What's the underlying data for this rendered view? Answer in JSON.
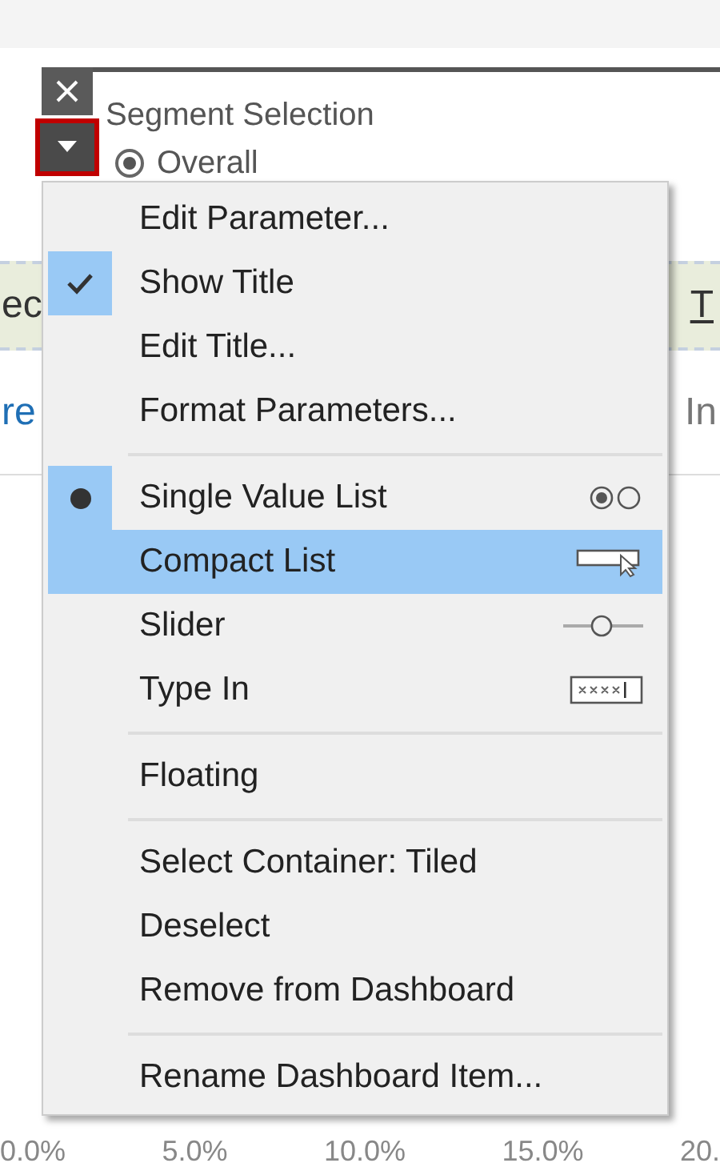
{
  "panel": {
    "title": "Segment Selection",
    "option": {
      "label": "Overall",
      "selected": true
    }
  },
  "background": {
    "band_left": "ec",
    "band_right": "T",
    "row_left": "re",
    "row_right": "In",
    "axis_ticks": [
      "0.0%",
      "5.0%",
      "10.0%",
      "15.0%",
      "20."
    ]
  },
  "menu": {
    "items": [
      {
        "kind": "command",
        "label": "Edit Parameter...",
        "highlighted": false
      },
      {
        "kind": "toggle",
        "label": "Show Title",
        "checked": true,
        "highlighted": false
      },
      {
        "kind": "command",
        "label": "Edit Title...",
        "highlighted": false
      },
      {
        "kind": "command",
        "label": "Format Parameters...",
        "highlighted": false
      },
      {
        "kind": "separator"
      },
      {
        "kind": "mode",
        "label": "Single Value List",
        "selected": true,
        "highlighted": false
      },
      {
        "kind": "mode",
        "label": "Compact List",
        "selected": false,
        "highlighted": true
      },
      {
        "kind": "mode",
        "label": "Slider",
        "selected": false,
        "highlighted": false
      },
      {
        "kind": "mode",
        "label": "Type In",
        "selected": false,
        "highlighted": false
      },
      {
        "kind": "separator"
      },
      {
        "kind": "toggle",
        "label": "Floating",
        "checked": false,
        "highlighted": false
      },
      {
        "kind": "separator"
      },
      {
        "kind": "command",
        "label": "Select Container: Tiled",
        "highlighted": false
      },
      {
        "kind": "command",
        "label": "Deselect",
        "highlighted": false
      },
      {
        "kind": "command",
        "label": "Remove from Dashboard",
        "highlighted": false
      },
      {
        "kind": "separator"
      },
      {
        "kind": "command",
        "label": "Rename Dashboard Item...",
        "highlighted": false
      }
    ]
  }
}
